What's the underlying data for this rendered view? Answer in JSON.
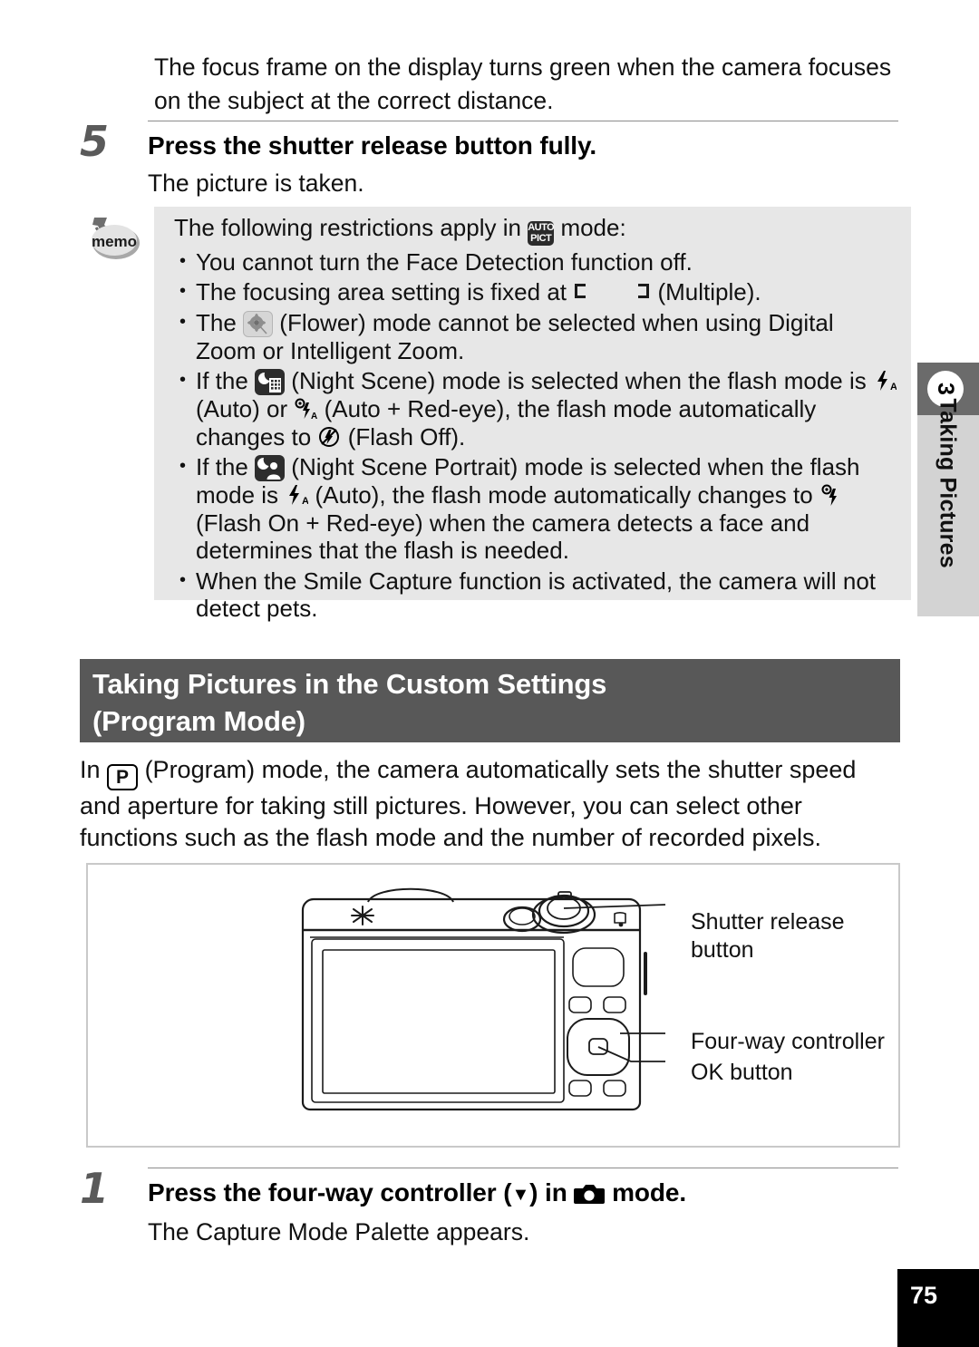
{
  "page": {
    "number": "75",
    "chapter_tab": {
      "number": "3",
      "label": "Taking Pictures"
    }
  },
  "intro_note": {
    "line1": "The focus frame on the display turns green when the camera focuses",
    "line2": "on the subject at the correct distance."
  },
  "step5": {
    "number": "5",
    "title": "Press the shutter release button fully.",
    "sub": "The picture is taken."
  },
  "memo": {
    "icon_label": "memo",
    "lead_before": "The following restrictions apply in",
    "lead_icon": "auto-pict-icon",
    "lead_after": "mode:",
    "items": [
      {
        "id": "face-detection",
        "parts": [
          {
            "type": "text",
            "value": "You cannot turn the Face Detection function off."
          }
        ]
      },
      {
        "id": "focusing-area",
        "parts": [
          {
            "type": "text",
            "value": "The focusing area setting is fixed at"
          },
          {
            "type": "icon",
            "value": "multiple-focus-bracket-icon"
          },
          {
            "type": "text",
            "value": "(Multiple)."
          }
        ]
      },
      {
        "id": "flower-mode",
        "parts": [
          {
            "type": "text",
            "value": "The"
          },
          {
            "type": "icon",
            "value": "flower-mode-icon"
          },
          {
            "type": "text",
            "value": "(Flower) mode cannot be selected when using Digital Zoom or Intelligent Zoom."
          }
        ]
      },
      {
        "id": "night-scene",
        "parts": [
          {
            "type": "text",
            "value": "If the"
          },
          {
            "type": "icon",
            "value": "night-scene-icon"
          },
          {
            "type": "text",
            "value": "(Night Scene) mode is selected when the flash mode is"
          },
          {
            "type": "icon",
            "value": "flash-auto-icon"
          },
          {
            "type": "text",
            "value": "(Auto) or"
          },
          {
            "type": "icon",
            "value": "flash-auto-redeye-icon"
          },
          {
            "type": "text",
            "value": "(Auto + Red-eye), the flash mode automatically changes to"
          },
          {
            "type": "icon",
            "value": "flash-off-icon"
          },
          {
            "type": "text",
            "value": "(Flash Off)."
          }
        ]
      },
      {
        "id": "night-scene-portrait",
        "parts": [
          {
            "type": "text",
            "value": "If the"
          },
          {
            "type": "icon",
            "value": "night-scene-portrait-icon"
          },
          {
            "type": "text",
            "value": "(Night Scene Portrait) mode is selected when the flash mode is"
          },
          {
            "type": "icon",
            "value": "flash-auto-icon"
          },
          {
            "type": "text",
            "value": "(Auto), the flash mode automatically changes to"
          },
          {
            "type": "icon",
            "value": "flash-on-redeye-icon"
          },
          {
            "type": "text",
            "value": "(Flash On + Red-eye) when the camera detects a face and determines that the flash is needed."
          }
        ]
      },
      {
        "id": "smile-capture",
        "parts": [
          {
            "type": "text",
            "value": "When the Smile Capture function is activated, the camera will not detect pets."
          }
        ]
      }
    ]
  },
  "section": {
    "heading_line1": "Taking Pictures in the Custom Settings",
    "heading_line2": "(Program Mode)",
    "intro_before": "In",
    "intro_icon": "program-mode-icon",
    "intro_after_line1": "(Program) mode, the camera automatically sets the shutter speed",
    "intro_line2": "and aperture for taking still pictures. However, you can select other",
    "intro_line3": "functions such as the flash mode and the number of recorded pixels."
  },
  "figure": {
    "callouts": [
      {
        "id": "shutter-release",
        "line1": "Shutter release",
        "line2": "button"
      },
      {
        "id": "four-way-controller",
        "line1": "Four-way controller"
      },
      {
        "id": "ok-button",
        "bold": "OK",
        "rest": "button"
      }
    ]
  },
  "step1": {
    "number": "1",
    "title_before": "Press the four-way controller (",
    "title_arrow": "▼",
    "title_mid": ") in",
    "title_icon": "camera-mode-icon",
    "title_after": "mode.",
    "sub": "The Capture Mode Palette appears."
  },
  "colors": {
    "banner_bg": "#585858",
    "memo_bg": "#e7e7e7",
    "tab_bg": "#d3d3d3",
    "tab_head_bg": "#6b6b6b",
    "step_number": "#5a5a5a",
    "page_num_bg": "#000000"
  }
}
